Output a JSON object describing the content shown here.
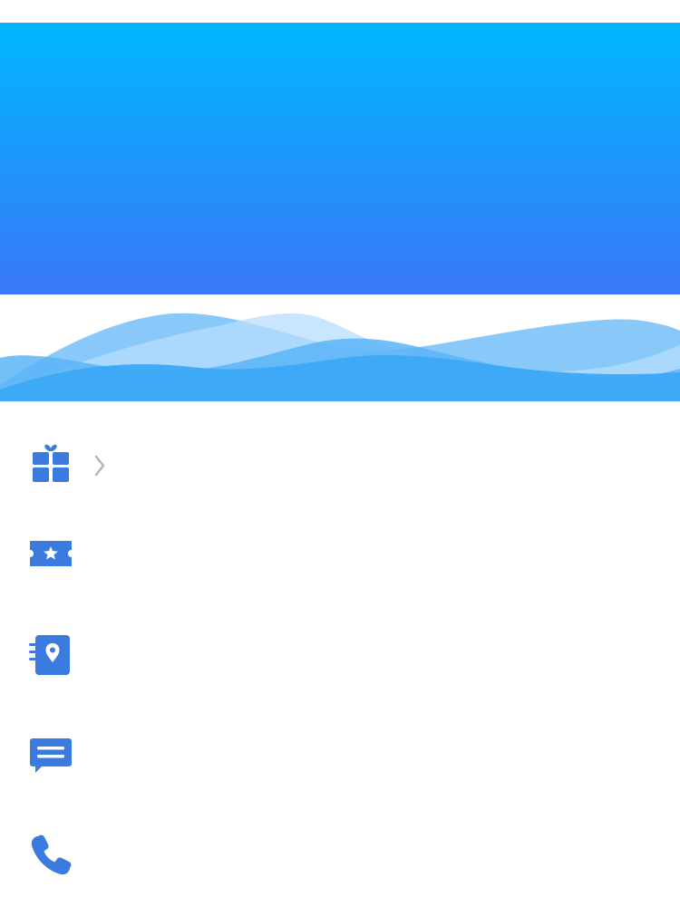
{
  "colors": {
    "header_top": "#00B7FE",
    "header_bottom": "#3A77F8",
    "icon_blue": "#3B7BE0",
    "chevron_gray": "#B5B5B5",
    "wave_light": "#B7DEFD",
    "wave_mid": "#7CC3FA",
    "wave_dark": "#4AAEF6"
  },
  "menu": {
    "items": [
      {
        "label": "",
        "icon": "gift-icon",
        "has_chevron": true
      },
      {
        "label": "",
        "icon": "ticket-icon",
        "has_chevron": false
      },
      {
        "label": "",
        "icon": "address-book-icon",
        "has_chevron": false
      },
      {
        "label": "",
        "icon": "message-icon",
        "has_chevron": false
      },
      {
        "label": "",
        "icon": "phone-icon",
        "has_chevron": false
      }
    ]
  }
}
